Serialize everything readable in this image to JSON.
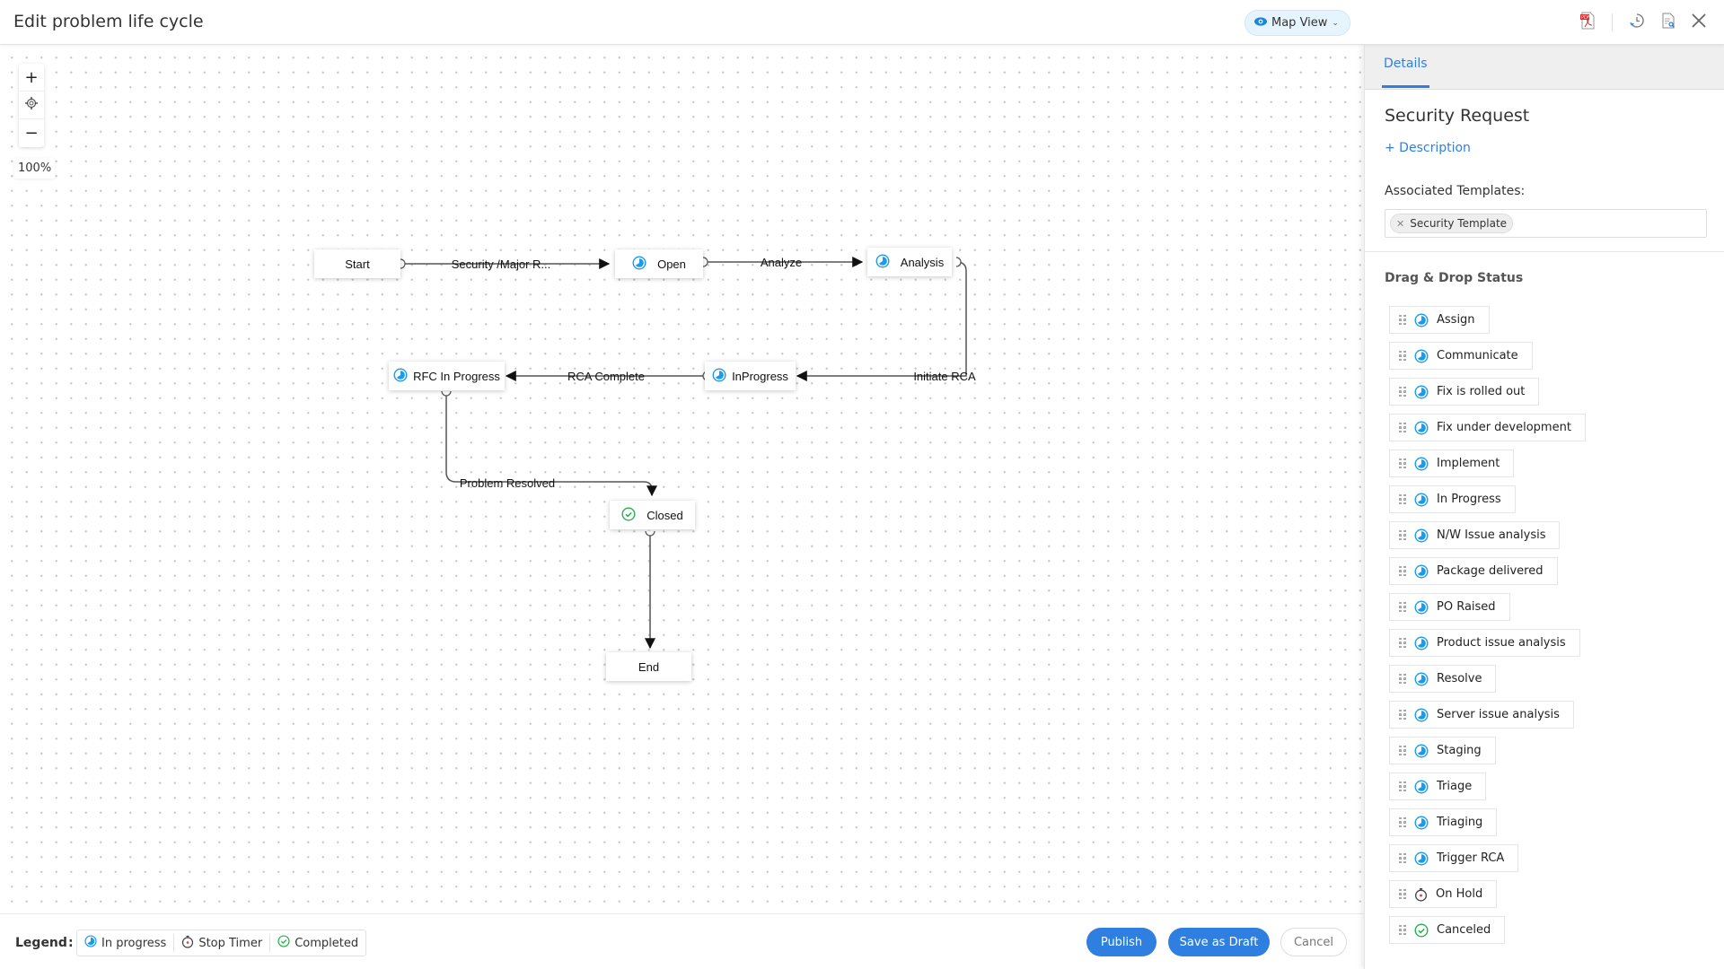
{
  "header": {
    "title": "Edit problem life cycle",
    "view_selector": {
      "label": "Map View",
      "icon": "eye-icon"
    },
    "actions": [
      {
        "name": "export-pdf",
        "icon": "pdf-icon"
      },
      {
        "name": "history",
        "icon": "history-icon"
      },
      {
        "name": "preview",
        "icon": "document-search-icon"
      },
      {
        "name": "close",
        "icon": "close-icon"
      }
    ]
  },
  "canvas": {
    "zoom_in": "+",
    "zoom_out": "−",
    "zoom_level": "100%",
    "nodes": [
      {
        "id": "start",
        "label": "Start",
        "icon": null
      },
      {
        "id": "open",
        "label": "Open",
        "icon": "in-progress"
      },
      {
        "id": "analysis",
        "label": "Analysis",
        "icon": "in-progress"
      },
      {
        "id": "inprogress",
        "label": "InProgress",
        "icon": "in-progress"
      },
      {
        "id": "rfc",
        "label": "RFC In Progress",
        "icon": "in-progress"
      },
      {
        "id": "closed",
        "label": "Closed",
        "icon": "completed"
      },
      {
        "id": "end",
        "label": "End",
        "icon": null
      }
    ],
    "transitions": [
      {
        "from": "start",
        "to": "open",
        "label": "Security /Major R..."
      },
      {
        "from": "open",
        "to": "analysis",
        "label": "Analyze"
      },
      {
        "from": "analysis",
        "to": "inprogress",
        "label": "Initiate RCA"
      },
      {
        "from": "inprogress",
        "to": "rfc",
        "label": "RCA Complete"
      },
      {
        "from": "rfc",
        "to": "closed",
        "label": "Problem Resolved"
      },
      {
        "from": "closed",
        "to": "end",
        "label": ""
      }
    ]
  },
  "legend": {
    "label": "Legend",
    "separator": ":",
    "items": [
      {
        "label": "In progress",
        "icon": "in-progress"
      },
      {
        "label": "Stop Timer",
        "icon": "stop-timer"
      },
      {
        "label": "Completed",
        "icon": "completed"
      }
    ]
  },
  "footer": {
    "publish": "Publish",
    "save_draft": "Save as Draft",
    "cancel": "Cancel"
  },
  "panel": {
    "tab": "Details",
    "title": "Security Request",
    "add_description": "+ Description",
    "associated_templates_label": "Associated Templates:",
    "associated_templates": [
      "Security Template"
    ],
    "drag_drop_label": "Drag & Drop Status",
    "statuses": [
      {
        "label": "Assign",
        "icon": "in-progress"
      },
      {
        "label": "Communicate",
        "icon": "in-progress"
      },
      {
        "label": "Fix is rolled out",
        "icon": "in-progress"
      },
      {
        "label": "Fix under development",
        "icon": "in-progress"
      },
      {
        "label": "Implement",
        "icon": "in-progress"
      },
      {
        "label": "In Progress",
        "icon": "in-progress"
      },
      {
        "label": "N/W Issue analysis",
        "icon": "in-progress"
      },
      {
        "label": "Package delivered",
        "icon": "in-progress"
      },
      {
        "label": "PO Raised",
        "icon": "in-progress"
      },
      {
        "label": "Product issue analysis",
        "icon": "in-progress"
      },
      {
        "label": "Resolve",
        "icon": "in-progress"
      },
      {
        "label": "Server issue analysis",
        "icon": "in-progress"
      },
      {
        "label": "Staging",
        "icon": "in-progress"
      },
      {
        "label": "Triage",
        "icon": "in-progress"
      },
      {
        "label": "Triaging",
        "icon": "in-progress"
      },
      {
        "label": "Trigger RCA",
        "icon": "in-progress"
      },
      {
        "label": "On Hold",
        "icon": "stop-timer"
      },
      {
        "label": "Canceled",
        "icon": "completed"
      }
    ]
  },
  "colors": {
    "accent": "#2f7fe1",
    "transition_label": "#59dcb4",
    "in_progress_icon": "#1a9bf0",
    "completed_icon": "#22b14c",
    "stop_timer_dot": "#e53935"
  }
}
